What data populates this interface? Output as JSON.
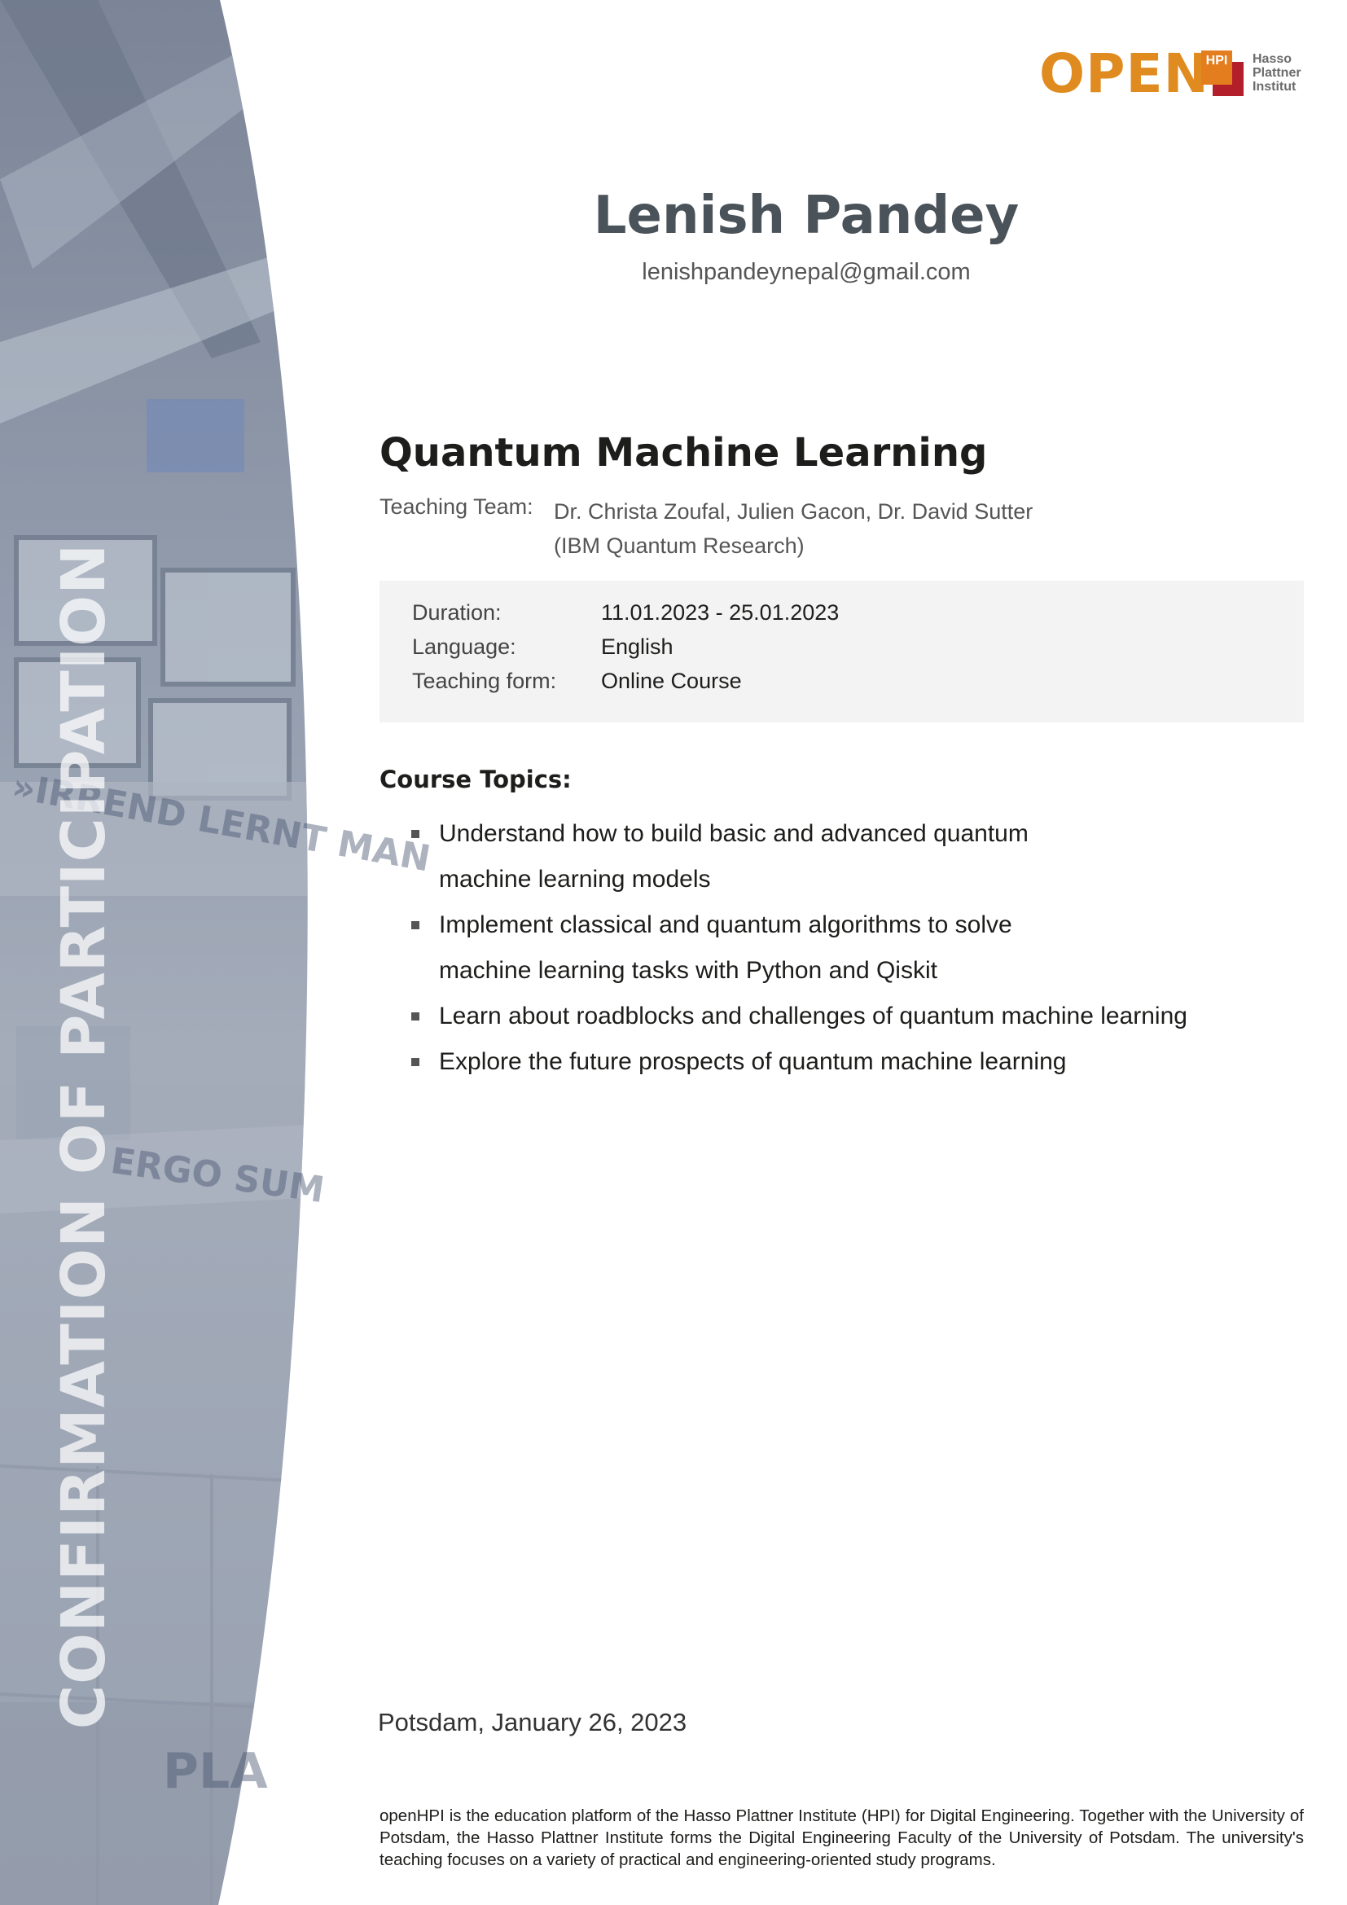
{
  "sidebar": {
    "vertical_title": "CONFIRMATION OF PARTICIPATION"
  },
  "logo": {
    "open": "OPEN",
    "mark": "HPI",
    "institute_lines": [
      "Hasso",
      "Plattner",
      "Institut"
    ],
    "colors": {
      "orange": "#e08b1f",
      "red": "#b21f2a"
    }
  },
  "recipient": {
    "name": "Lenish Pandey",
    "email": "lenishpandeynepal@gmail.com"
  },
  "course": {
    "title": "Quantum Machine Learning",
    "teaching_team_label": "Teaching Team:",
    "teaching_team": "Dr. Christa Zoufal, Julien Gacon, Dr. David Sutter",
    "teaching_team_org": "(IBM Quantum Research)"
  },
  "details": [
    {
      "label": "Duration:",
      "value": "11.01.2023 - 25.01.2023"
    },
    {
      "label": "Language:",
      "value": "English"
    },
    {
      "label": "Teaching form:",
      "value": "Online Course"
    }
  ],
  "topics": {
    "title": "Course Topics:",
    "items": [
      [
        "Understand how to build basic and advanced quantum",
        "machine learning models"
      ],
      [
        "Implement classical and quantum algorithms to solve",
        "machine learning tasks with Python and Qiskit"
      ],
      [
        "Learn about roadblocks and challenges of quantum machine learning"
      ],
      [
        "Explore the future prospects of quantum machine learning"
      ]
    ]
  },
  "place_date": "Potsdam, January 26, 2023",
  "footer": "openHPI is the education platform of the Hasso Plattner Institute (HPI) for Digital Engineering. Together with the University of Potsdam, the Hasso Plattner Institute forms the Digital Engineering Faculty of the University of Potsdam. The university's teaching focuses on a variety of practical and engineering-oriented study programs."
}
